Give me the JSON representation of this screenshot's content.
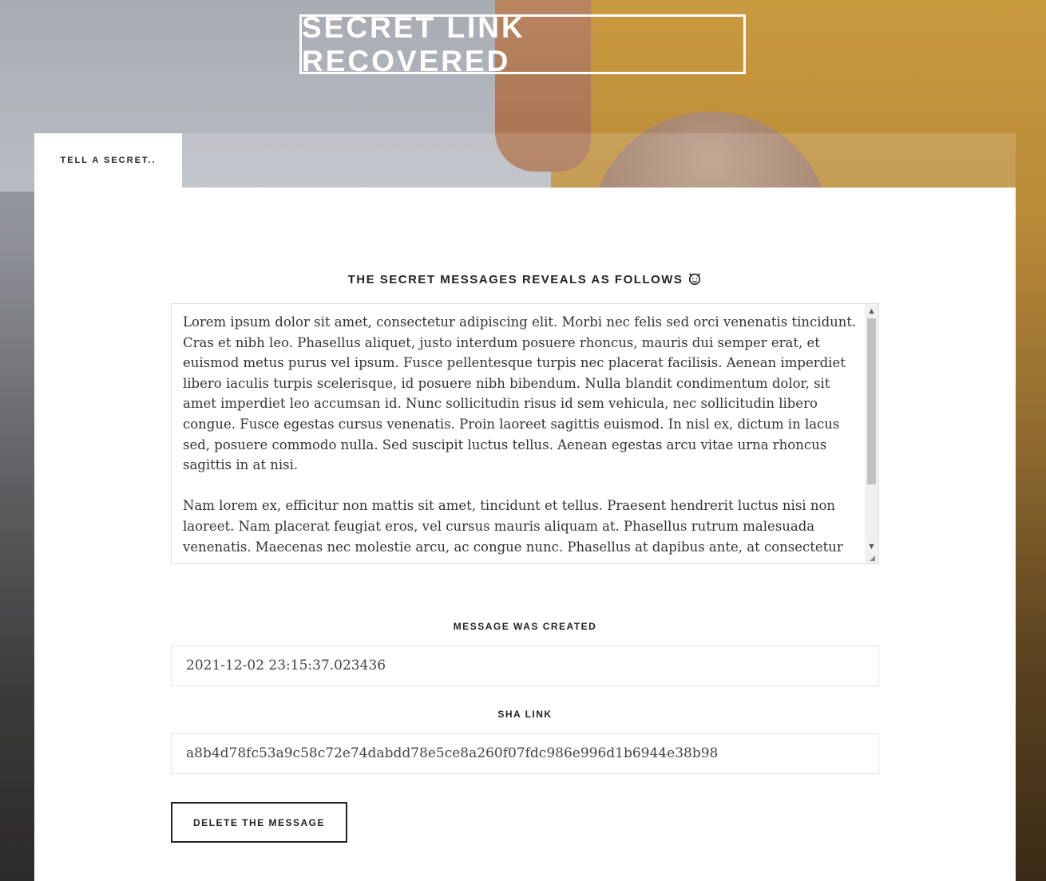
{
  "header": {
    "title": "SECRET LINK RECOVERED"
  },
  "tabs": [
    {
      "label": "TELL A SECRET.."
    }
  ],
  "main": {
    "section_title": "THE SECRET MESSAGES REVEALS AS FOLLOWS",
    "section_icon": "devil-face-icon",
    "message": "Lorem ipsum dolor sit amet, consectetur adipiscing elit. Morbi nec felis sed orci venenatis tincidunt. Cras et nibh leo. Phasellus aliquet, justo interdum posuere rhoncus, mauris dui semper erat, et euismod metus purus vel ipsum. Fusce pellentesque turpis nec placerat facilisis. Aenean imperdiet libero iaculis turpis scelerisque, id posuere nibh bibendum. Nulla blandit condimentum dolor, sit amet imperdiet leo accumsan id. Nunc sollicitudin risus id sem vehicula, nec sollicitudin libero congue. Fusce egestas cursus venenatis. Proin laoreet sagittis euismod. In nisl ex, dictum in lacus sed, posuere commodo nulla. Sed suscipit luctus tellus. Aenean egestas arcu vitae urna rhoncus sagittis in at nisi.\n\nNam lorem ex, efficitur non mattis sit amet, tincidunt et tellus. Praesent hendrerit luctus nisi non laoreet. Nam placerat feugiat eros, vel cursus mauris aliquam at. Phasellus rutrum malesuada venenatis. Maecenas nec molestie arcu, ac congue nunc. Phasellus at dapibus ante, at consectetur",
    "created_label": "MESSAGE WAS CREATED",
    "created_value": "2021-12-02 23:15:37.023436",
    "sha_label": "SHA LINK",
    "sha_value": "a8b4d78fc53a9c58c72e74dabdd78e5ce8a260f07fdc986e996d1b6944e38b98",
    "delete_label": "DELETE THE MESSAGE"
  },
  "colors": {
    "text_dark": "#222222",
    "card_bg": "#ffffff"
  }
}
